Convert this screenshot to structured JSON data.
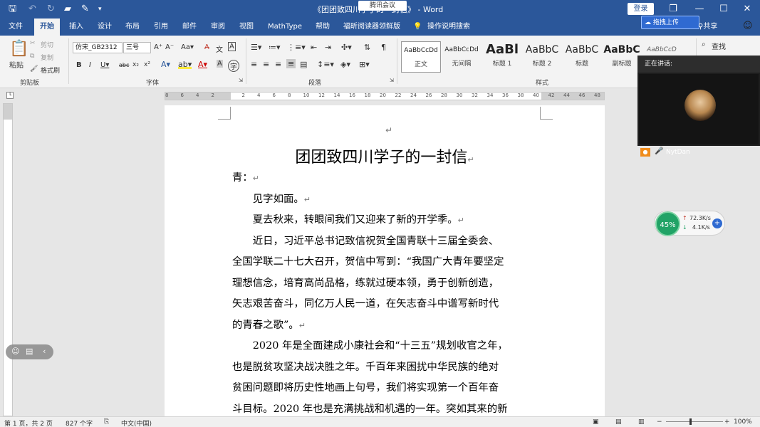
{
  "window": {
    "title": "《团团致四川学子的一封信》 - Word",
    "login_label": "登录",
    "meeting_pill": "腾讯会议",
    "buttons": {
      "restore": "❐",
      "minimize": "—",
      "maximize": "☐",
      "close": "✕"
    }
  },
  "tabs": [
    "文件",
    "开始",
    "插入",
    "设计",
    "布局",
    "引用",
    "邮件",
    "审阅",
    "视图",
    "MathType",
    "帮助",
    "福昕阅读器领鲜版",
    "操作说明搜索"
  ],
  "active_tab": "开始",
  "share_label": "共享",
  "sync_label": "拖拽上传",
  "ribbon": {
    "clipboard": {
      "paste": "粘贴",
      "cut": "剪切",
      "copy": "复制",
      "format_painter": "格式刷",
      "label": "剪贴板"
    },
    "font": {
      "name": "仿宋_GB2312",
      "size": "三号",
      "label": "字体"
    },
    "paragraph": {
      "label": "段落"
    },
    "styles": {
      "label": "样式",
      "items": [
        {
          "preview": "AaBbCcDd",
          "name": "正文"
        },
        {
          "preview": "AaBbCcDd",
          "name": "无间隔"
        },
        {
          "preview": "AaBl",
          "name": "标题 1"
        },
        {
          "preview": "AaBbC",
          "name": "标题 2"
        },
        {
          "preview": "AaBbC",
          "name": "标题"
        },
        {
          "preview": "AaBbC",
          "name": "副标题"
        },
        {
          "preview": "AaBbCcD",
          "name": ""
        }
      ]
    },
    "editing": {
      "find": "查找"
    }
  },
  "ruler_ticks": [
    "8",
    "6",
    "4",
    "2",
    "",
    "2",
    "4",
    "6",
    "8",
    "10",
    "12",
    "14",
    "16",
    "18",
    "20",
    "22",
    "24",
    "26",
    "28",
    "30",
    "32",
    "34",
    "36",
    "38",
    "40",
    "42",
    "44",
    "46",
    "48"
  ],
  "document": {
    "heading": "团团致四川学子的一封信",
    "paragraphs": [
      "青：",
      "　　见字如面。",
      "　　夏去秋来，转眼间我们又迎来了新的开学季。",
      "　　近日，习近平总书记致信祝贺全国青联十三届全委会、",
      "全国学联二十七大召开，贺信中写到：“我国广大青年要坚定",
      "理想信念，培育高尚品格，练就过硬本领，勇于创新创造，",
      "矢志艰苦奋斗，同亿万人民一道，在矢志奋斗中谱写新时代",
      "的青春之歌”。",
      "　　2020 年是全面建成小康社会和“十三五”规划收官之年，",
      "也是脱贫攻坚决战决胜之年。千百年来困扰中华民族的绝对",
      "贫困问题即将历史性地画上句号，我们将实现第一个百年奋",
      "斗目标。2020 年也是充满挑战和机遇的一年。突如其来的新"
    ],
    "paragraph_end_flags": [
      true,
      true,
      true,
      false,
      false,
      false,
      false,
      true,
      false,
      false,
      false,
      false
    ]
  },
  "status": {
    "page": "第 1 页，共 2 页",
    "words": "827 个字",
    "language": "中文(中国)",
    "zoom": "100%"
  },
  "meeting": {
    "header": "正在讲话:",
    "speaker": "NytDan"
  },
  "network": {
    "percent": "45%",
    "up": "72.3K/s",
    "down": "4.1K/s"
  }
}
